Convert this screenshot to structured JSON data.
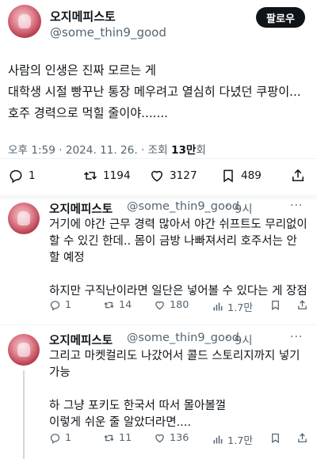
{
  "main": {
    "display_name": "오지메피스토",
    "handle": "@some_thin9_good",
    "follow_label": "팔로우",
    "body": "사람의 인생은 진짜 모르는 게\n대학생 시절 빵꾸난 통장 메우려고 열심히 다녔던 쿠팡이... 호주 경력으로 먹힐 줄이야.......",
    "time": "오후 1:59",
    "date": "2024. 11. 26.",
    "views_label": "조회",
    "views_count": "13만",
    "views_suffix": "회",
    "sep": "·",
    "stats": {
      "replies": "1",
      "retweets": "1194",
      "likes": "3127",
      "bookmarks": "489"
    }
  },
  "replies": [
    {
      "display_name": "오지메피스토",
      "handle": "@some_thin9_good",
      "age": "9시",
      "sep": "·",
      "more": "···",
      "body": "거기에 야간 근무 경력 많아서 야간 쉬프트도 무리없이 할 수 있긴 한데.. 몸이 금방 나빠져서리 호주서는 안 할 예정\n\n하지만 구직난이라면 일단은 넣어볼 수 있다는 게 장점",
      "stats": {
        "replies": "1",
        "retweets": "14",
        "likes": "180",
        "views": "1.7만"
      }
    },
    {
      "display_name": "오지메피스토",
      "handle": "@some_thin9_good",
      "age": "9시",
      "sep": "·",
      "more": "···",
      "body": "그리고 마켓컬리도 나갔어서 콜드 스토리지까지 넣기 가능\n\n하 그냥 포키도 한국서 따서 몰아볼껄\n이렇게 쉬운 줄 알았더라면....",
      "stats": {
        "replies": "1",
        "retweets": "11",
        "likes": "136",
        "views": "1.7만"
      }
    }
  ],
  "colors": {
    "text": "#0f1419",
    "secondary": "#536471",
    "divider": "#eff3f4",
    "button_bg": "#0f1419"
  },
  "icons": [
    "reply-icon",
    "retweet-icon",
    "like-icon",
    "bookmark-icon",
    "share-icon",
    "views-icon",
    "more-icon"
  ]
}
